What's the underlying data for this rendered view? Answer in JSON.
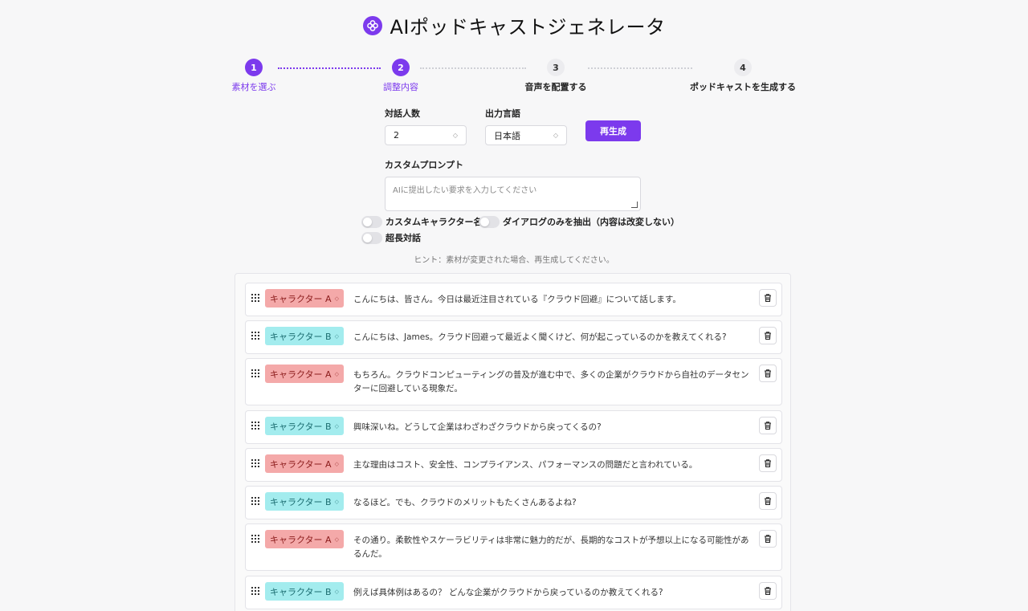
{
  "app": {
    "title": "AIポッドキャストジェネレータ"
  },
  "steps": [
    {
      "number": "1",
      "label": "素材を選ぶ"
    },
    {
      "number": "2",
      "label": "調整内容"
    },
    {
      "number": "3",
      "label": "音声を配置する"
    },
    {
      "number": "4",
      "label": "ポッドキャストを生成する"
    }
  ],
  "form": {
    "speakers_label": "対話人数",
    "speakers_value": "2",
    "language_label": "出力言語",
    "language_value": "日本語",
    "regenerate_label": "再生成",
    "prompt_label": "カスタムプロンプト",
    "prompt_placeholder": "AIに提出したい要求を入力してください"
  },
  "toggles": {
    "custom_character": "カスタムキャラクター名",
    "dialog_only": "ダイアログのみを抽出（内容は改変しない）",
    "long_dialog": "超長対話"
  },
  "hint": "ヒント：素材が変更された場合、再生成してください。",
  "dialog": [
    {
      "character": "キャラクター A",
      "text": "こんにちは、皆さん。今日は最近注目されている『クラウド回避』について話します。"
    },
    {
      "character": "キャラクター B",
      "text": "こんにちは、James。クラウド回避って最近よく聞くけど、何が起こっているのかを教えてくれる?"
    },
    {
      "character": "キャラクター A",
      "text": "もちろん。クラウドコンピューティングの普及が進む中で、多くの企業がクラウドから自社のデータセンターに回避している現象だ。"
    },
    {
      "character": "キャラクター B",
      "text": "興味深いね。どうして企業はわざわざクラウドから戻ってくるの?"
    },
    {
      "character": "キャラクター A",
      "text": "主な理由はコスト、安全性、コンプライアンス、パフォーマンスの問題だと言われている。"
    },
    {
      "character": "キャラクター B",
      "text": "なるほど。でも、クラウドのメリットもたくさんあるよね?"
    },
    {
      "character": "キャラクター A",
      "text": "その通り。柔軟性やスケーラビリティは非常に魅力的だが、長期的なコストが予想以上になる可能性があるんだ。"
    },
    {
      "character": "キャラクター B",
      "text": "例えば具体例はあるの？ どんな企業がクラウドから戻っているのか教えてくれる?"
    }
  ],
  "colors": {
    "accent": "#7c3aed",
    "character_a_bg": "#f4a9a9",
    "character_b_bg": "#a3ecee"
  }
}
